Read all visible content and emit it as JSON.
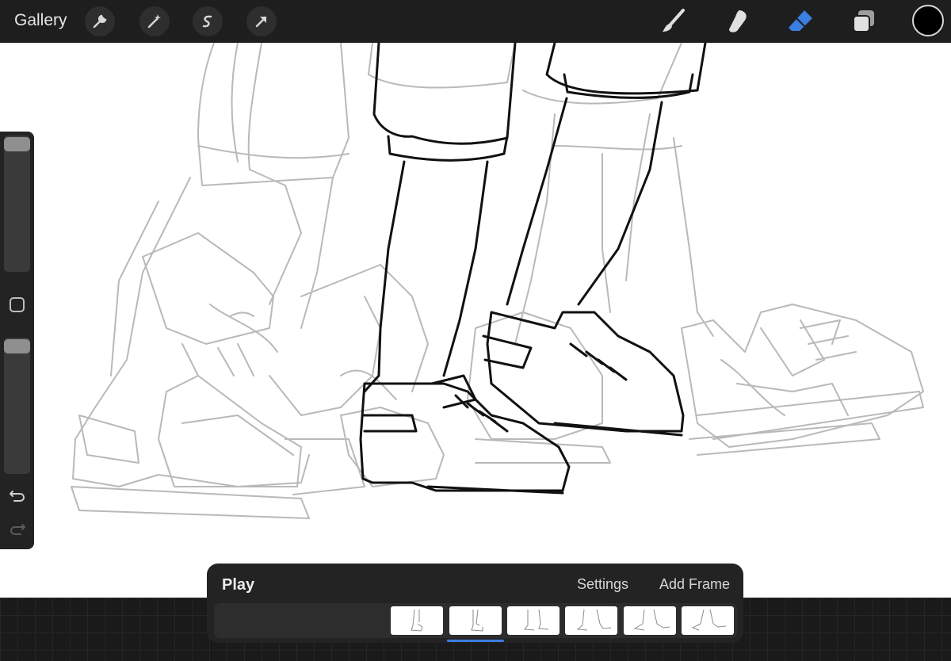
{
  "app": {
    "gallery_label": "Gallery"
  },
  "toolbar": {
    "actions": [
      "wrench-icon",
      "magic-wand-icon",
      "selection-icon",
      "transform-arrow-icon"
    ],
    "tools": [
      "brush-icon",
      "smudge-icon",
      "eraser-icon",
      "layers-icon"
    ],
    "active_tool": "eraser-icon",
    "accent_color": "#3b7de0",
    "current_color": "#000000"
  },
  "sidebar": {
    "brush_size_level": 0.05,
    "opacity_level": 0.05,
    "modify_button": "square-icon",
    "undo": "undo-icon",
    "redo": "redo-icon"
  },
  "animation": {
    "play_label": "Play",
    "settings_label": "Settings",
    "add_frame_label": "Add Frame",
    "frame_count": 6,
    "selected_frame": 2
  }
}
